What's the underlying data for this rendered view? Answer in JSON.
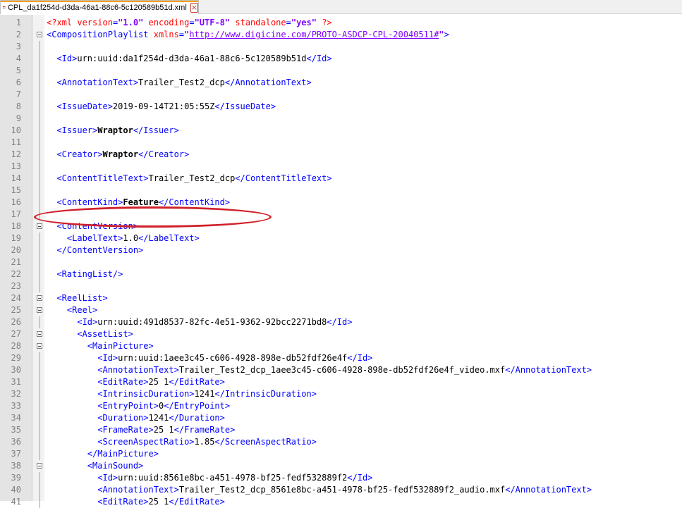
{
  "tab": {
    "filename": "CPL_da1f254d-d3da-46a1-88c6-5c120589b51d.xml",
    "icon": "notepad-file-icon",
    "close_icon": "close-icon"
  },
  "colors": {
    "tag": "#0000ff",
    "attribute": "#ff0000",
    "string": "#8000ff",
    "highlight_ring": "#d0202a",
    "tab_accent": "#f7a21b"
  },
  "annotation": {
    "type": "red-ellipse",
    "encircles_line": 16
  },
  "lines": [
    {
      "n": "1",
      "fold": "none",
      "segs": [
        [
          "decl",
          "<?xml "
        ],
        [
          "attr",
          "version"
        ],
        [
          "tag",
          "="
        ],
        [
          "str",
          "\"1.0\""
        ],
        [
          "attr",
          " encoding"
        ],
        [
          "tag",
          "="
        ],
        [
          "str",
          "\"UTF-8\""
        ],
        [
          "attr",
          " standalone"
        ],
        [
          "tag",
          "="
        ],
        [
          "str",
          "\"yes\""
        ],
        [
          "decl",
          " ?>"
        ]
      ]
    },
    {
      "n": "2",
      "fold": "open",
      "segs": [
        [
          "tag",
          "<CompositionPlaylist "
        ],
        [
          "attr",
          "xmlns"
        ],
        [
          "tag",
          "="
        ],
        [
          "str",
          "\""
        ],
        [
          "url",
          "http://www.digicine.com/PROTO-ASDCP-CPL-20040511#"
        ],
        [
          "str",
          "\""
        ],
        [
          "tag",
          ">"
        ]
      ]
    },
    {
      "n": "3",
      "fold": "line",
      "segs": []
    },
    {
      "n": "4",
      "fold": "line",
      "segs": [
        [
          "tag",
          "  <Id>"
        ],
        [
          "txt",
          "urn:uuid:da1f254d-d3da-46a1-88c6-5c120589b51d"
        ],
        [
          "tag",
          "</Id>"
        ]
      ]
    },
    {
      "n": "5",
      "fold": "line",
      "segs": []
    },
    {
      "n": "6",
      "fold": "line",
      "segs": [
        [
          "tag",
          "  <AnnotationText>"
        ],
        [
          "txt",
          "Trailer_Test2_dcp"
        ],
        [
          "tag",
          "</AnnotationText>"
        ]
      ]
    },
    {
      "n": "7",
      "fold": "line",
      "segs": []
    },
    {
      "n": "8",
      "fold": "line",
      "segs": [
        [
          "tag",
          "  <IssueDate>"
        ],
        [
          "txt",
          "2019-09-14T21:05:55Z"
        ],
        [
          "tag",
          "</IssueDate>"
        ]
      ]
    },
    {
      "n": "9",
      "fold": "line",
      "segs": []
    },
    {
      "n": "10",
      "fold": "line",
      "segs": [
        [
          "tag",
          "  <Issuer>"
        ],
        [
          "bold",
          "Wraptor"
        ],
        [
          "tag",
          "</Issuer>"
        ]
      ]
    },
    {
      "n": "11",
      "fold": "line",
      "segs": []
    },
    {
      "n": "12",
      "fold": "line",
      "segs": [
        [
          "tag",
          "  <Creator>"
        ],
        [
          "bold",
          "Wraptor"
        ],
        [
          "tag",
          "</Creator>"
        ]
      ]
    },
    {
      "n": "13",
      "fold": "line",
      "segs": []
    },
    {
      "n": "14",
      "fold": "line",
      "segs": [
        [
          "tag",
          "  <ContentTitleText>"
        ],
        [
          "txt",
          "Trailer_Test2_dcp"
        ],
        [
          "tag",
          "</ContentTitleText>"
        ]
      ]
    },
    {
      "n": "15",
      "fold": "line",
      "segs": []
    },
    {
      "n": "16",
      "fold": "line",
      "segs": [
        [
          "tag",
          "  <ContentKind>"
        ],
        [
          "bold",
          "Feature"
        ],
        [
          "tag",
          "</ContentKind>"
        ]
      ]
    },
    {
      "n": "17",
      "fold": "line",
      "segs": []
    },
    {
      "n": "18",
      "fold": "open",
      "segs": [
        [
          "tag",
          "  <ContentVersion>"
        ]
      ]
    },
    {
      "n": "19",
      "fold": "line",
      "segs": [
        [
          "tag",
          "    <LabelText>"
        ],
        [
          "txt",
          "1.0"
        ],
        [
          "tag",
          "</LabelText>"
        ]
      ]
    },
    {
      "n": "20",
      "fold": "line",
      "segs": [
        [
          "tag",
          "  </ContentVersion>"
        ]
      ]
    },
    {
      "n": "21",
      "fold": "line",
      "segs": []
    },
    {
      "n": "22",
      "fold": "line",
      "segs": [
        [
          "tag",
          "  <RatingList/>"
        ]
      ]
    },
    {
      "n": "23",
      "fold": "line",
      "segs": []
    },
    {
      "n": "24",
      "fold": "open",
      "segs": [
        [
          "tag",
          "  <ReelList>"
        ]
      ]
    },
    {
      "n": "25",
      "fold": "open",
      "segs": [
        [
          "tag",
          "    <Reel>"
        ]
      ]
    },
    {
      "n": "26",
      "fold": "line",
      "segs": [
        [
          "tag",
          "      <Id>"
        ],
        [
          "txt",
          "urn:uuid:491d8537-82fc-4e51-9362-92bcc2271bd8"
        ],
        [
          "tag",
          "</Id>"
        ]
      ]
    },
    {
      "n": "27",
      "fold": "open",
      "segs": [
        [
          "tag",
          "      <AssetList>"
        ]
      ]
    },
    {
      "n": "28",
      "fold": "open",
      "segs": [
        [
          "tag",
          "        <MainPicture>"
        ]
      ]
    },
    {
      "n": "29",
      "fold": "line",
      "segs": [
        [
          "tag",
          "          <Id>"
        ],
        [
          "txt",
          "urn:uuid:1aee3c45-c606-4928-898e-db52fdf26e4f"
        ],
        [
          "tag",
          "</Id>"
        ]
      ]
    },
    {
      "n": "30",
      "fold": "line",
      "segs": [
        [
          "tag",
          "          <AnnotationText>"
        ],
        [
          "txt",
          "Trailer_Test2_dcp_1aee3c45-c606-4928-898e-db52fdf26e4f_video.mxf"
        ],
        [
          "tag",
          "</AnnotationText>"
        ]
      ]
    },
    {
      "n": "31",
      "fold": "line",
      "segs": [
        [
          "tag",
          "          <EditRate>"
        ],
        [
          "txt",
          "25 1"
        ],
        [
          "tag",
          "</EditRate>"
        ]
      ]
    },
    {
      "n": "32",
      "fold": "line",
      "segs": [
        [
          "tag",
          "          <IntrinsicDuration>"
        ],
        [
          "txt",
          "1241"
        ],
        [
          "tag",
          "</IntrinsicDuration>"
        ]
      ]
    },
    {
      "n": "33",
      "fold": "line",
      "segs": [
        [
          "tag",
          "          <EntryPoint>"
        ],
        [
          "txt",
          "0"
        ],
        [
          "tag",
          "</EntryPoint>"
        ]
      ]
    },
    {
      "n": "34",
      "fold": "line",
      "segs": [
        [
          "tag",
          "          <Duration>"
        ],
        [
          "txt",
          "1241"
        ],
        [
          "tag",
          "</Duration>"
        ]
      ]
    },
    {
      "n": "35",
      "fold": "line",
      "segs": [
        [
          "tag",
          "          <FrameRate>"
        ],
        [
          "txt",
          "25 1"
        ],
        [
          "tag",
          "</FrameRate>"
        ]
      ]
    },
    {
      "n": "36",
      "fold": "line",
      "segs": [
        [
          "tag",
          "          <ScreenAspectRatio>"
        ],
        [
          "txt",
          "1.85"
        ],
        [
          "tag",
          "</ScreenAspectRatio>"
        ]
      ]
    },
    {
      "n": "37",
      "fold": "line",
      "segs": [
        [
          "tag",
          "        </MainPicture>"
        ]
      ]
    },
    {
      "n": "38",
      "fold": "open",
      "segs": [
        [
          "tag",
          "        <MainSound>"
        ]
      ]
    },
    {
      "n": "39",
      "fold": "line",
      "segs": [
        [
          "tag",
          "          <Id>"
        ],
        [
          "txt",
          "urn:uuid:8561e8bc-a451-4978-bf25-fedf532889f2"
        ],
        [
          "tag",
          "</Id>"
        ]
      ]
    },
    {
      "n": "40",
      "fold": "line",
      "segs": [
        [
          "tag",
          "          <AnnotationText>"
        ],
        [
          "txt",
          "Trailer_Test2_dcp_8561e8bc-a451-4978-bf25-fedf532889f2_audio.mxf"
        ],
        [
          "tag",
          "</AnnotationText>"
        ]
      ]
    },
    {
      "n": "41",
      "fold": "line",
      "segs": [
        [
          "tag",
          "          <EditRate>"
        ],
        [
          "txt",
          "25 1"
        ],
        [
          "tag",
          "</EditRate>"
        ]
      ]
    }
  ]
}
